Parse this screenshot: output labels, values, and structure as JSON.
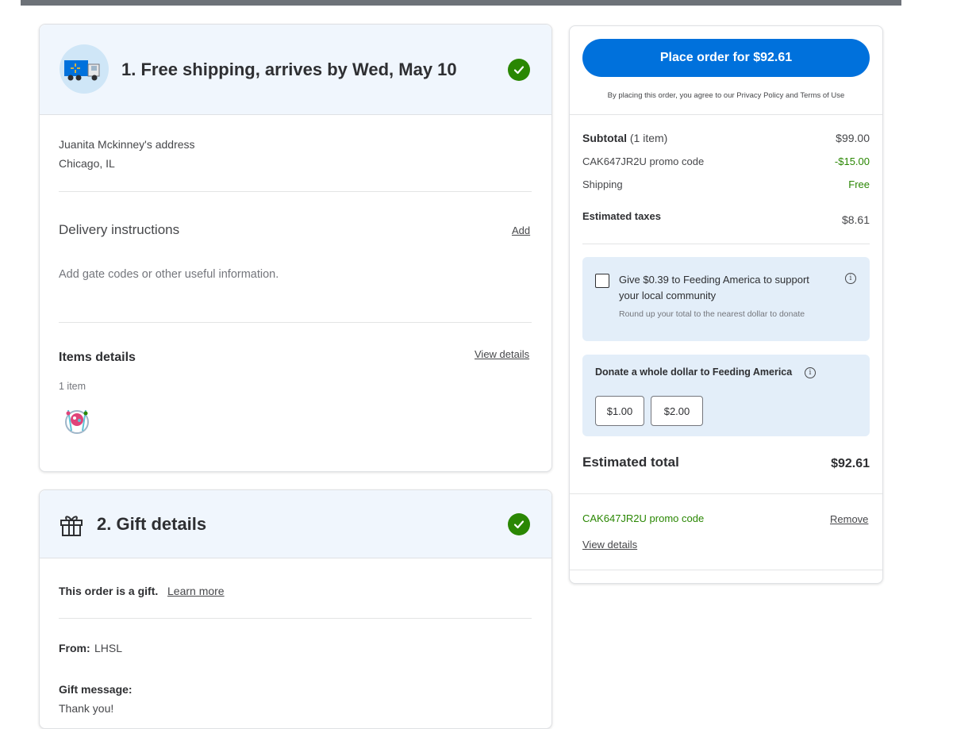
{
  "colors": {
    "accent": "#0071dc",
    "success": "#2a8703",
    "header_bg": "#f0f6fd",
    "panel_bg": "#e3eef9"
  },
  "shipping": {
    "title": "1. Free shipping, arrives by Wed, May 10",
    "address_name": "Juanita Mckinney's address",
    "address_city": "Chicago, IL",
    "delivery_label": "Delivery instructions",
    "delivery_add": "Add",
    "delivery_placeholder": "Add gate codes or other useful information.",
    "items_label": "Items details",
    "items_view": "View details",
    "items_count": "1 item"
  },
  "gift": {
    "title": "2. Gift details",
    "is_gift": "This order is a gift.",
    "learn_more": "Learn more",
    "from_label": "From:",
    "from_value": "LHSL",
    "message_label": "Gift message:",
    "message_value": "Thank you!"
  },
  "summary": {
    "place_order": "Place order for $92.61",
    "terms": "By placing this order, you agree to our Privacy Policy and Terms of Use",
    "subtotal_label": "Subtotal",
    "subtotal_count": "(1 item)",
    "subtotal_value": "$99.00",
    "promo_label": "CAK647JR2U promo code",
    "promo_value": "-$15.00",
    "shipping_label": "Shipping",
    "shipping_value": "Free",
    "taxes_label": "Estimated taxes",
    "taxes_value": "$8.61",
    "donate_round_line1": "Give $0.39 to Feeding America to support",
    "donate_round_line2": "your local community",
    "donate_round_sub": "Round up your total to the nearest dollar to donate",
    "donate_whole_label": "Donate a whole dollar to Feeding America",
    "donate_opt1": "$1.00",
    "donate_opt2": "$2.00",
    "total_label": "Estimated total",
    "total_value": "$92.61",
    "applied_promo": "CAK647JR2U promo code",
    "remove": "Remove",
    "view_details": "View details"
  },
  "icons": {
    "truck": "walmart-truck-icon",
    "gift": "gift-icon",
    "check": "check-circle-icon",
    "info": "info-icon"
  }
}
